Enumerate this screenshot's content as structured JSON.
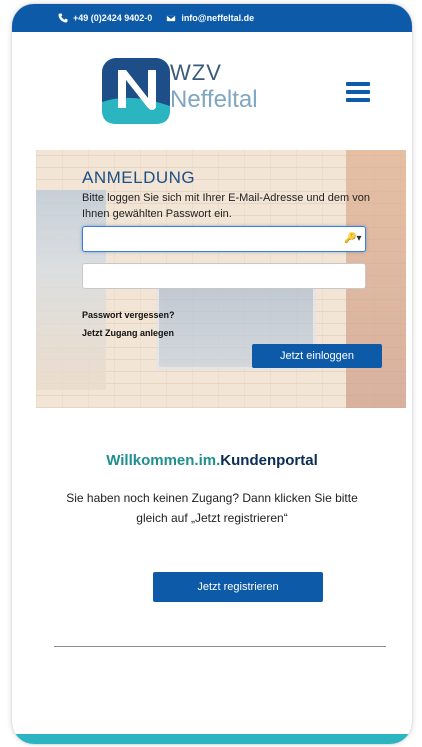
{
  "topbar": {
    "phone": "+49 (0)2424 9402-0",
    "email": "info@neffeltal.de"
  },
  "logo": {
    "line1": "WZV",
    "line2": "Neffeltal"
  },
  "login": {
    "title": "ANMELDUNG",
    "description": "Bitte loggen Sie sich mit Ihrer E-Mail-Adresse und dem von Ihnen gewählten Passwort ein.",
    "email_value": "",
    "password_value": "",
    "forgot_link": "Passwort vergessen?",
    "create_link": "Jetzt Zugang anlegen",
    "submit": "Jetzt einloggen"
  },
  "welcome": {
    "part1": "Willkommen",
    "dot1": ".",
    "part2": "im",
    "dot2": ".",
    "part3": "Kundenportal",
    "text": "Sie haben noch keinen Zugang? Dann klicken Sie bitte gleich auf „Jetzt registrieren“",
    "register_button": "Jetzt registrieren"
  },
  "colors": {
    "primary": "#0d5aa8",
    "teal": "#1f8f8f",
    "accent_bar": "#2bb5c1"
  }
}
